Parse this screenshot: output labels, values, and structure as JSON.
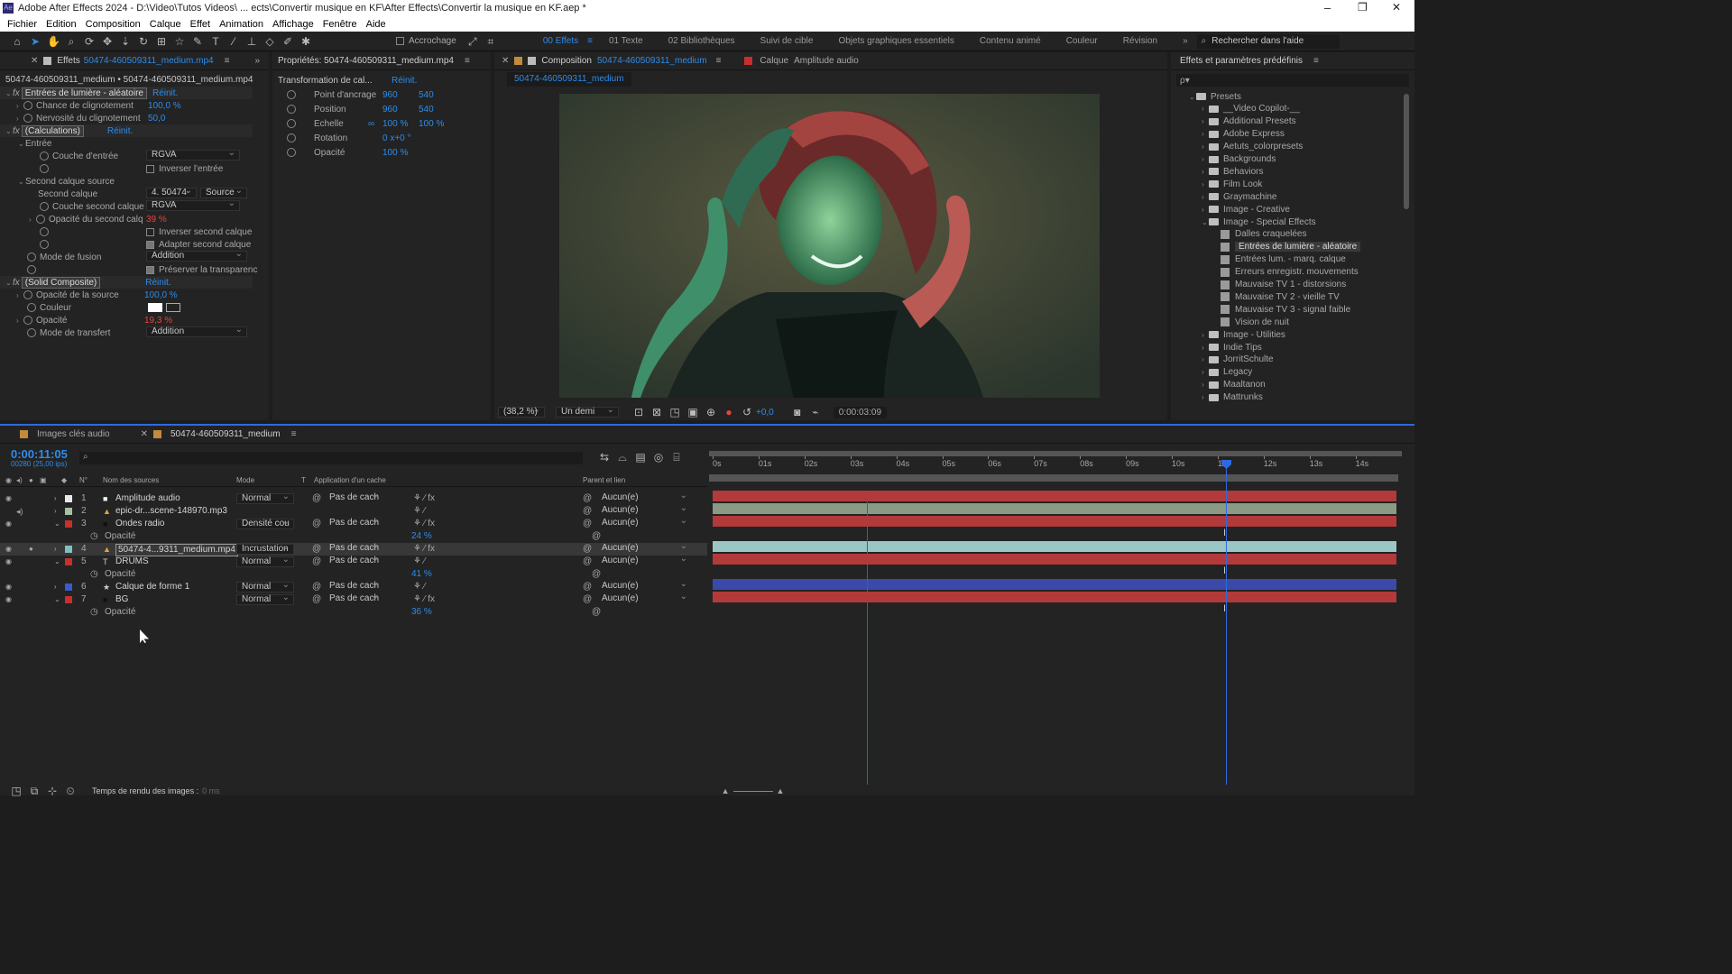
{
  "window": {
    "title": "Adobe After Effects 2024 - D:\\Video\\Tutos Videos\\ ... ects\\Convertir musique en KF\\After Effects\\Convertir la musique en KF.aep *",
    "min": "–",
    "max": "❐",
    "close": "✕"
  },
  "menu": [
    "Fichier",
    "Edition",
    "Composition",
    "Calque",
    "Effet",
    "Animation",
    "Affichage",
    "Fenêtre",
    "Aide"
  ],
  "toolbar": {
    "snapping": "Accrochage",
    "workspaces": [
      "00 Effets",
      "01 Texte",
      "02 Bibliothèques",
      "Suivi de cible",
      "Objets graphiques essentiels",
      "Contenu animé",
      "Couleur",
      "Révision"
    ],
    "more": "»",
    "search_placeholder": "Rechercher dans l'aide"
  },
  "effects_panel": {
    "tab": "Effets",
    "tab_file": "50474-460509311_medium.mp4",
    "breadcrumb": "50474-460509311_medium • 50474-460509311_medium.mp4",
    "fx1": {
      "name": "Entrées de lumière - aléatoire",
      "reset": "Réinit.",
      "chance_label": "Chance de clignotement",
      "chance_val": "100,0 %",
      "nerv_label": "Nervosité du clignotement",
      "nerv_val": "50,0"
    },
    "fx2": {
      "name": "(Calculations)",
      "reset": "Réinit.",
      "entree": "Entrée",
      "couche_entree": "Couche d'entrée",
      "couche_entree_val": "RGVA",
      "inverser_entree": "Inverser l'entrée",
      "second_source": "Second calque source",
      "second_calque": "Second calque",
      "second_calque_val": "4. 50474-",
      "second_calque_src": "Source",
      "couche_second": "Couche second calque",
      "couche_second_val": "RGVA",
      "opacite_second": "Opacité du second calqu",
      "opacite_second_val": "39 %",
      "inverser_second": "Inverser second calque",
      "adapter_second": "Adapter second calque",
      "mode_fusion": "Mode de fusion",
      "mode_fusion_val": "Addition",
      "preserver": "Préserver la transparenc"
    },
    "fx3": {
      "name": "(Solid Composite)",
      "reset": "Réinit.",
      "opacite_source": "Opacité de la source",
      "opacite_source_val": "100,0 %",
      "couleur": "Couleur",
      "opacite": "Opacité",
      "opacite_val": "19,3 %",
      "mode_transfert": "Mode de transfert",
      "mode_transfert_val": "Addition"
    }
  },
  "props_panel": {
    "tab": "Propriétés: 50474-460509311_medium.mp4",
    "section": "Transformation de cal...",
    "reset": "Réinit.",
    "ancre_label": "Point d'ancrage",
    "ancre_x": "960",
    "ancre_y": "540",
    "pos_label": "Position",
    "pos_x": "960",
    "pos_y": "540",
    "scale_label": "Echelle",
    "scale_x": "100 %",
    "scale_y": "100 %",
    "rot_label": "Rotation",
    "rot_val": "0 x+0 °",
    "op_label": "Opacité",
    "op_val": "100 %"
  },
  "comp_panel": {
    "tab_label": "Composition",
    "tab_name": "50474-460509311_medium",
    "layer_label": "Calque",
    "layer_name": "Amplitude audio",
    "comp_tab": "50474-460509311_medium",
    "zoom": "(38,2 %)",
    "res": "Un demi",
    "exposure": "+0,0",
    "timecode": "0:00:03:09"
  },
  "presets_panel": {
    "title": "Effets et paramètres prédéfinis",
    "search_placeholder": "ρ▾",
    "root": "Presets",
    "folders_a": [
      "__Video Copilot-__",
      "Additional Presets",
      "Adobe Express",
      "Aetuts_colorpresets",
      "Backgrounds",
      "Behaviors",
      "Film Look",
      "Graymachine",
      "Image - Creative",
      "Image - Special Effects"
    ],
    "special_items": [
      "Dalles craquelées",
      "Entrées de lumière - aléatoire",
      "Entrées lum. - marq. calque",
      "Erreurs enregistr. mouvements",
      "Mauvaise TV 1 - distorsions",
      "Mauvaise TV 2 - vieille TV",
      "Mauvaise TV 3 - signal faible",
      "Vision de nuit"
    ],
    "folders_b": [
      "Image - Utilities",
      "Indie Tips",
      "JorritSchulte",
      "Legacy",
      "Maaltanon",
      "Mattrunks"
    ]
  },
  "timeline": {
    "tab1": "Images clés audio",
    "tab2": "50474-460509311_medium",
    "timecode": "0:00:11:05",
    "fps": "00280 (25,00 ips)",
    "col_num": "N°",
    "col_name": "Nom des sources",
    "col_mode": "Mode",
    "col_t": "T",
    "col_cache": "Application d'un cache",
    "col_parent": "Parent et lien",
    "ruler": [
      "0s",
      "01s",
      "02s",
      "03s",
      "04s",
      "05s",
      "06s",
      "07s",
      "08s",
      "09s",
      "10s",
      "11s",
      "12s",
      "13s",
      "14s"
    ],
    "layers": [
      {
        "num": "1",
        "name": "Amplitude audio",
        "mode": "Normal",
        "cache": "Pas de cach",
        "parent": "Aucun(e)",
        "color": "#e8e8e8"
      },
      {
        "num": "2",
        "name": "epic-dr...scene-148970.mp3",
        "mode": "",
        "cache": "",
        "parent": "Aucun(e)",
        "color": "#a5c19e"
      },
      {
        "num": "3",
        "name": "Ondes radio",
        "mode": "Densité cou",
        "cache": "Pas de cach",
        "parent": "Aucun(e)",
        "color": "#c7302b"
      },
      {
        "num": "4",
        "name": "50474-4...9311_medium.mp4",
        "mode": "Incrustation",
        "cache": "Pas de cach",
        "parent": "Aucun(e)",
        "color": "#7ec1c0"
      },
      {
        "num": "5",
        "name": "DRUMS",
        "mode": "Normal",
        "cache": "Pas de cach",
        "parent": "Aucun(e)",
        "color": "#c7302b"
      },
      {
        "num": "6",
        "name": "Calque de forme 1",
        "mode": "Normal",
        "cache": "Pas de cach",
        "parent": "Aucun(e)",
        "color": "#3b5bc9"
      },
      {
        "num": "7",
        "name": "BG",
        "mode": "Normal",
        "cache": "Pas de cach",
        "parent": "Aucun(e)",
        "color": "#c7302b"
      }
    ],
    "sub_label": "Opacité",
    "sub3_val": "24 %",
    "sub5_val": "41 %",
    "sub7_val": "36 %",
    "status": "Temps de rendu des images :",
    "status_val": "0 ms"
  }
}
